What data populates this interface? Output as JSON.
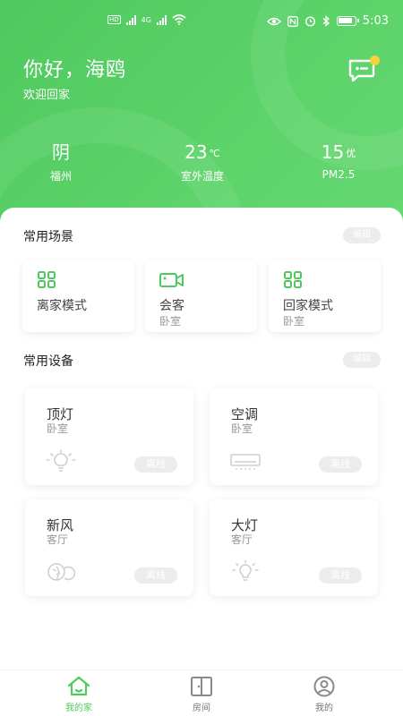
{
  "status_bar": {
    "time": "5:03",
    "network": "4G"
  },
  "header": {
    "greeting": "你好，海鸥",
    "welcome": "欢迎回家"
  },
  "weather": [
    {
      "value": "阴",
      "label": "福州"
    },
    {
      "value": "23",
      "unit": "℃",
      "label": "室外温度"
    },
    {
      "value": "15",
      "unit": "优",
      "label": "PM2.5"
    }
  ],
  "scenes_section": {
    "title": "常用场景",
    "edit_label": "编辑",
    "items": [
      {
        "name": "离家模式",
        "room": "",
        "icon": "grid-icon"
      },
      {
        "name": "会客",
        "room": "卧室",
        "icon": "video-icon"
      },
      {
        "name": "回家模式",
        "room": "卧室",
        "icon": "grid-icon"
      }
    ]
  },
  "devices_section": {
    "title": "常用设备",
    "edit_label": "编辑",
    "items": [
      {
        "name": "顶灯",
        "room": "卧室",
        "status": "离线",
        "icon": "ceiling-light-icon"
      },
      {
        "name": "空调",
        "room": "卧室",
        "status": "离线",
        "icon": "air-conditioner-icon"
      },
      {
        "name": "新风",
        "room": "客厅",
        "status": "离线",
        "icon": "fresh-air-icon"
      },
      {
        "name": "大灯",
        "room": "客厅",
        "status": "离线",
        "icon": "bulb-icon"
      }
    ]
  },
  "tabbar": [
    {
      "label": "我的家",
      "icon": "home-icon",
      "active": true
    },
    {
      "label": "房间",
      "icon": "door-icon",
      "active": false
    },
    {
      "label": "我的",
      "icon": "profile-icon",
      "active": false
    }
  ],
  "colors": {
    "accent": "#4fc95f",
    "badge": "#f6d23c",
    "offline_chip": "#ececec"
  }
}
